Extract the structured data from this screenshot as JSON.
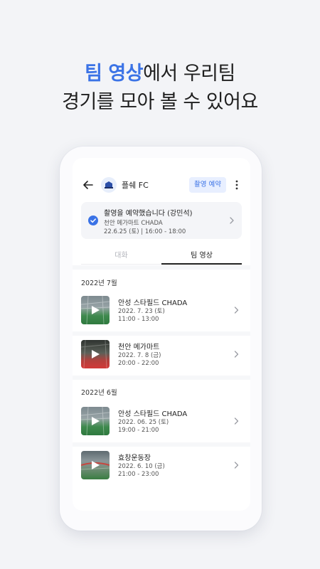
{
  "headline": {
    "accent": "팀 영상",
    "line1_rest": "에서 우리팀",
    "line2": "경기를 모아 볼 수 있어요"
  },
  "appbar": {
    "team_name": "플쉐 FC",
    "reserve_label": "촬영 예약"
  },
  "notice": {
    "title": "촬영을 예약했습니다 (강민석)",
    "place": "천안 메가마트 CHADA",
    "time": "22.6.25 (토)  |  16:00 - 18:00"
  },
  "tabs": {
    "chat": "대화",
    "video": "팀 영상"
  },
  "sections": [
    {
      "title": "2022년 7월",
      "items": [
        {
          "title": "안성 스타필드 CHADA",
          "date": "2022. 7. 23 (토)",
          "time": "11:00 - 13:00",
          "thumb": "indoor-pitch"
        },
        {
          "title": "천안 메가마트",
          "date": "2022. 7. 8 (금)",
          "time": "20:00 - 22:00",
          "thumb": "red-pitch"
        }
      ]
    },
    {
      "title": "2022년 6월",
      "items": [
        {
          "title": "안성 스타필드 CHADA",
          "date": "2022. 06. 25 (토)",
          "time": "19:00 - 21:00",
          "thumb": "indoor-pitch"
        },
        {
          "title": "효창운동장",
          "date": "2022. 6. 10 (금)",
          "time": "21:00 - 23:00",
          "thumb": "stadium-field"
        }
      ]
    }
  ],
  "colors": {
    "accent": "#3b73e6",
    "background": "#f3f4f7"
  },
  "icons": [
    "back-arrow-icon",
    "team-logo-icon",
    "more-vertical-icon",
    "check-circle-icon",
    "chevron-right-icon",
    "play-icon"
  ]
}
